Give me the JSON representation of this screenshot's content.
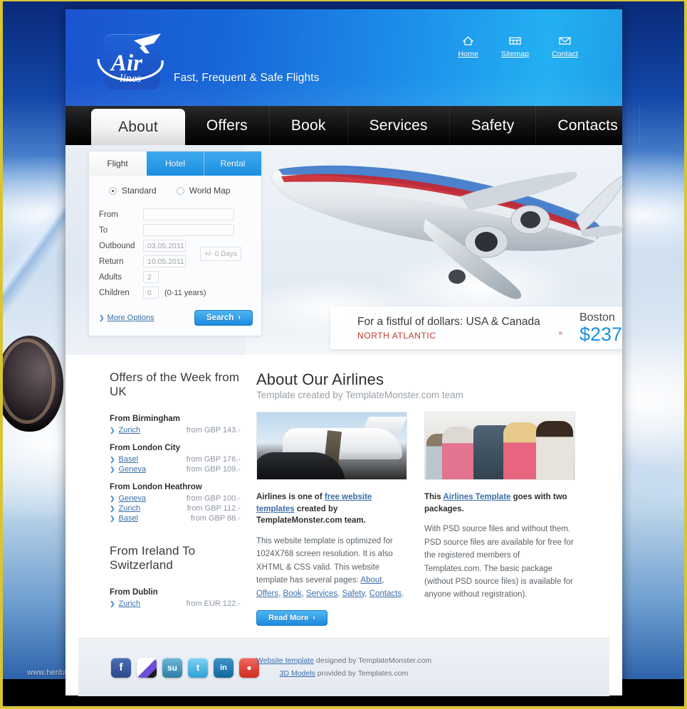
{
  "header": {
    "logo_text_top": "Air",
    "logo_text_bottom": "lines",
    "tagline": "Fast, Frequent & Safe Flights",
    "toplinks": [
      {
        "label": "Home",
        "icon": "home-icon"
      },
      {
        "label": "Sitemap",
        "icon": "sitemap-icon"
      },
      {
        "label": "Contact",
        "icon": "envelope-icon"
      }
    ]
  },
  "nav": {
    "items": [
      {
        "label": "About",
        "active": true
      },
      {
        "label": "Offers",
        "active": false
      },
      {
        "label": "Book",
        "active": false
      },
      {
        "label": "Services",
        "active": false
      },
      {
        "label": "Safety",
        "active": false
      },
      {
        "label": "Contacts",
        "active": false
      }
    ]
  },
  "booking": {
    "tabs": [
      {
        "label": "Flight",
        "active": true
      },
      {
        "label": "Hotel",
        "active": false
      },
      {
        "label": "Rental",
        "active": false
      }
    ],
    "modes": [
      {
        "label": "Standard",
        "selected": true
      },
      {
        "label": "World Map",
        "selected": false
      }
    ],
    "fields": {
      "from_label": "From",
      "from_value": "",
      "to_label": "To",
      "to_value": "",
      "outbound_label": "Outbound",
      "outbound_value": "03.05.2011",
      "return_label": "Return",
      "return_value": "10.05.2011",
      "days_value": "+/- 0 Days",
      "adults_label": "Adults",
      "adults_value": "2",
      "children_label": "Children",
      "children_value": "0",
      "children_note": "(0-11 years)"
    },
    "more_options_label": "More Options",
    "search_label": "Search",
    "search_arrow": "›"
  },
  "promo": {
    "title": "For a fistful of dollars: USA & Canada",
    "subtitle": "NORTH ATLANTIC",
    "arrow": "»",
    "city": "Boston",
    "price": "$237"
  },
  "offers": {
    "title": "Offers of the Week from UK",
    "groups": [
      {
        "from": "From Birmingham",
        "rows": [
          {
            "city": "Zurich",
            "price": "from GBP 143.-"
          }
        ]
      },
      {
        "from": "From London City",
        "rows": [
          {
            "city": "Basel",
            "price": "from GBP 176.-"
          },
          {
            "city": "Geneva",
            "price": "from GBP 109.-"
          }
        ]
      },
      {
        "from": "From London Heathrow",
        "rows": [
          {
            "city": "Geneva",
            "price": "from GBP 100.-"
          },
          {
            "city": "Zurich",
            "price": "from GBP 112.-"
          },
          {
            "city": "Basel",
            "price": "from GBP 88.-"
          }
        ]
      }
    ],
    "title2": "From Ireland To Switzerland",
    "groups2": [
      {
        "from": "From Dublin",
        "rows": [
          {
            "city": "Zurich",
            "price": "from EUR 122.-"
          }
        ]
      }
    ]
  },
  "about": {
    "title": "About Our Airlines",
    "subtitle": "Template created by TemplateMonster.com team",
    "photos": [
      {
        "alt": "business-jet-boarding-photo"
      },
      {
        "alt": "passengers-in-cabin-photo"
      }
    ],
    "col_left": {
      "lead_a": "Airlines is one of ",
      "lead_link": "free website templates",
      "lead_b": " created by TemplateMonster.com team.",
      "body_a": "This website template is optimized for 1024X768 screen resolution. It is also XHTML & CSS valid. This website template has several pages: ",
      "links": [
        "About",
        "Offers",
        "Book",
        "Services",
        "Safety",
        "Contacts"
      ]
    },
    "col_right": {
      "lead_a": "This ",
      "lead_link": "Airlines Template",
      "lead_b": " goes with two packages.",
      "body": "With PSD source files and without them. PSD source files are available for free for the registered members of Templates.com. The basic package (without PSD source files) is available for anyone without registration)."
    },
    "read_more_label": "Read More",
    "read_more_arrow": "›"
  },
  "footer": {
    "social": [
      {
        "name": "facebook-icon",
        "glyph": "f",
        "color": "#3b5998"
      },
      {
        "name": "delicious-icon",
        "glyph": "",
        "color": "#2b2b2b"
      },
      {
        "name": "stumbleupon-icon",
        "glyph": "su",
        "color": "#3f8fb5"
      },
      {
        "name": "twitter-icon",
        "glyph": "t",
        "color": "#45b0e3"
      },
      {
        "name": "linkedin-icon",
        "glyph": "in",
        "color": "#1b76b8"
      },
      {
        "name": "reddit-icon",
        "glyph": "●",
        "color": "#e03a2f"
      }
    ],
    "line1_link": "Website template",
    "line1_text": " designed by TemplateMonster.com",
    "line2_link": "3D Models",
    "line2_text": " provided by Templates.com"
  },
  "watermark": "www.heritagechristiancollege.com"
}
